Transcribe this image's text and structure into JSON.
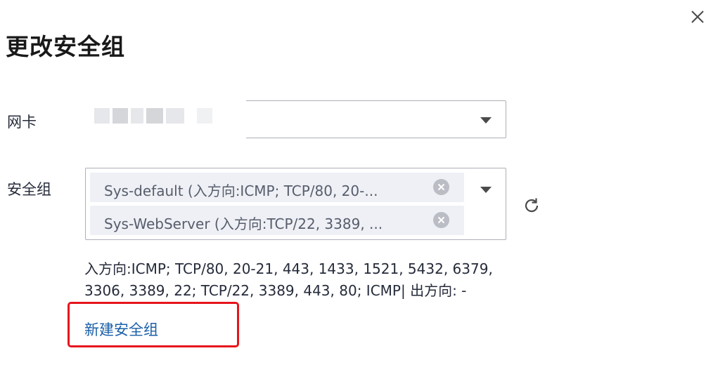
{
  "dialog": {
    "title": "更改安全组",
    "close_icon": "close-icon"
  },
  "nic": {
    "label": "网卡",
    "value": ""
  },
  "security_group": {
    "label": "安全组",
    "selected": [
      {
        "text": "Sys-default (入方向:ICMP; TCP/80, 20-..."
      },
      {
        "text": "Sys-WebServer (入方向:TCP/22, 3389, ..."
      }
    ],
    "refresh_icon": "refresh-icon",
    "dropdown_icon": "chevron-down-icon"
  },
  "rules_summary": {
    "line1": "入方向:ICMP; TCP/80, 20-21, 443, 1433, 1521, 5432, 6379,",
    "line2": "3306, 3389, 22; TCP/22, 3389, 443, 80; ICMP| 出方向: -"
  },
  "create_link": {
    "label": "新建安全组"
  },
  "colors": {
    "link": "#1a5fa8",
    "highlight": "#e6141c",
    "tag_bg": "#eef0f5"
  }
}
